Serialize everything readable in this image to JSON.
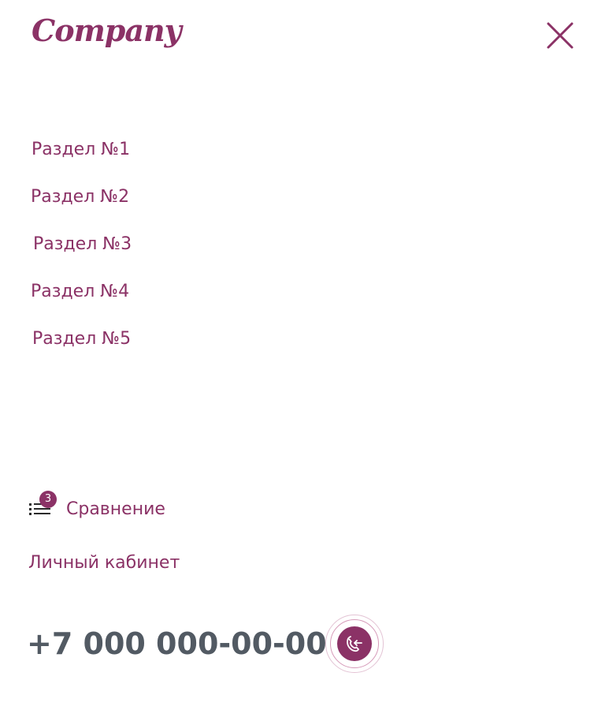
{
  "header": {
    "logo_text": "Company",
    "close_icon": "close-icon"
  },
  "nav": {
    "items": [
      {
        "label": "Раздел №1"
      },
      {
        "label": "Раздел №2"
      },
      {
        "label": "Раздел №3"
      },
      {
        "label": "Раздел №4"
      },
      {
        "label": "Раздел №5"
      }
    ]
  },
  "compare": {
    "icon": "list-icon",
    "badge_count": "3",
    "label": "Сравнение"
  },
  "account": {
    "label": "Личный кабинет"
  },
  "contact": {
    "phone": "+7 000 000-00-00",
    "callback_icon": "phone-callback-icon"
  },
  "colors": {
    "accent": "#8b3266",
    "phone_text": "#525a63",
    "background": "#ffffff"
  }
}
